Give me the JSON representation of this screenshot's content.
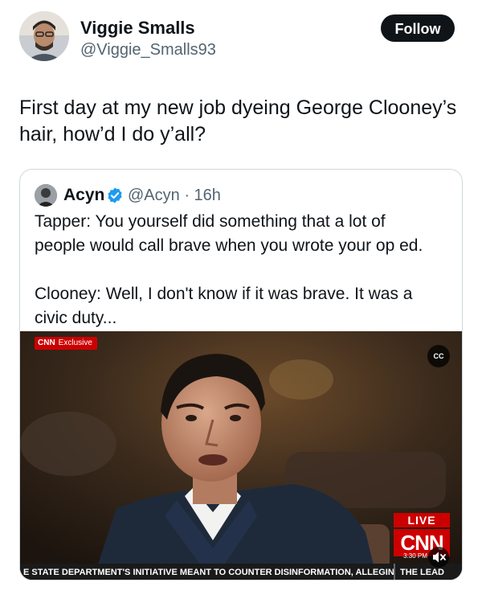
{
  "author": {
    "display_name": "Viggie Smalls",
    "handle": "@Viggie_Smalls93",
    "avatar_icon": "person-avatar"
  },
  "follow_label": "Follow",
  "tweet_text": "First day at my new job dyeing George Clooney’s\nhair, how’d I do y’all?",
  "quote": {
    "display_name": "Acyn",
    "verified_icon": "verified-badge-icon",
    "handle_time": "@Acyn · 16h",
    "text": "Tapper: You yourself did something that a lot of\npeople would call brave when you wrote your op ed.\n\nClooney: Well, I don't know if it was brave. It was a\ncivic duty...",
    "video": {
      "network_tag": "CNN",
      "exclusive_label": "Exclusive",
      "cc_label": "CC",
      "live_label": "LIVE",
      "logo": "CNN",
      "clock": "3:30 PM",
      "ticker": "E STATE DEPARTMENT'S INITIATIVE MEANT TO COUNTER DISINFORMATION, ALLEGING",
      "ticker_tag": "THE LEAD",
      "mute_icon": "speaker-mute-icon"
    }
  },
  "colors": {
    "text": "#0f1419",
    "secondary": "#536471",
    "verified": "#1d9bf0",
    "cnn_red": "#cc0000",
    "border": "#cfd9de"
  }
}
